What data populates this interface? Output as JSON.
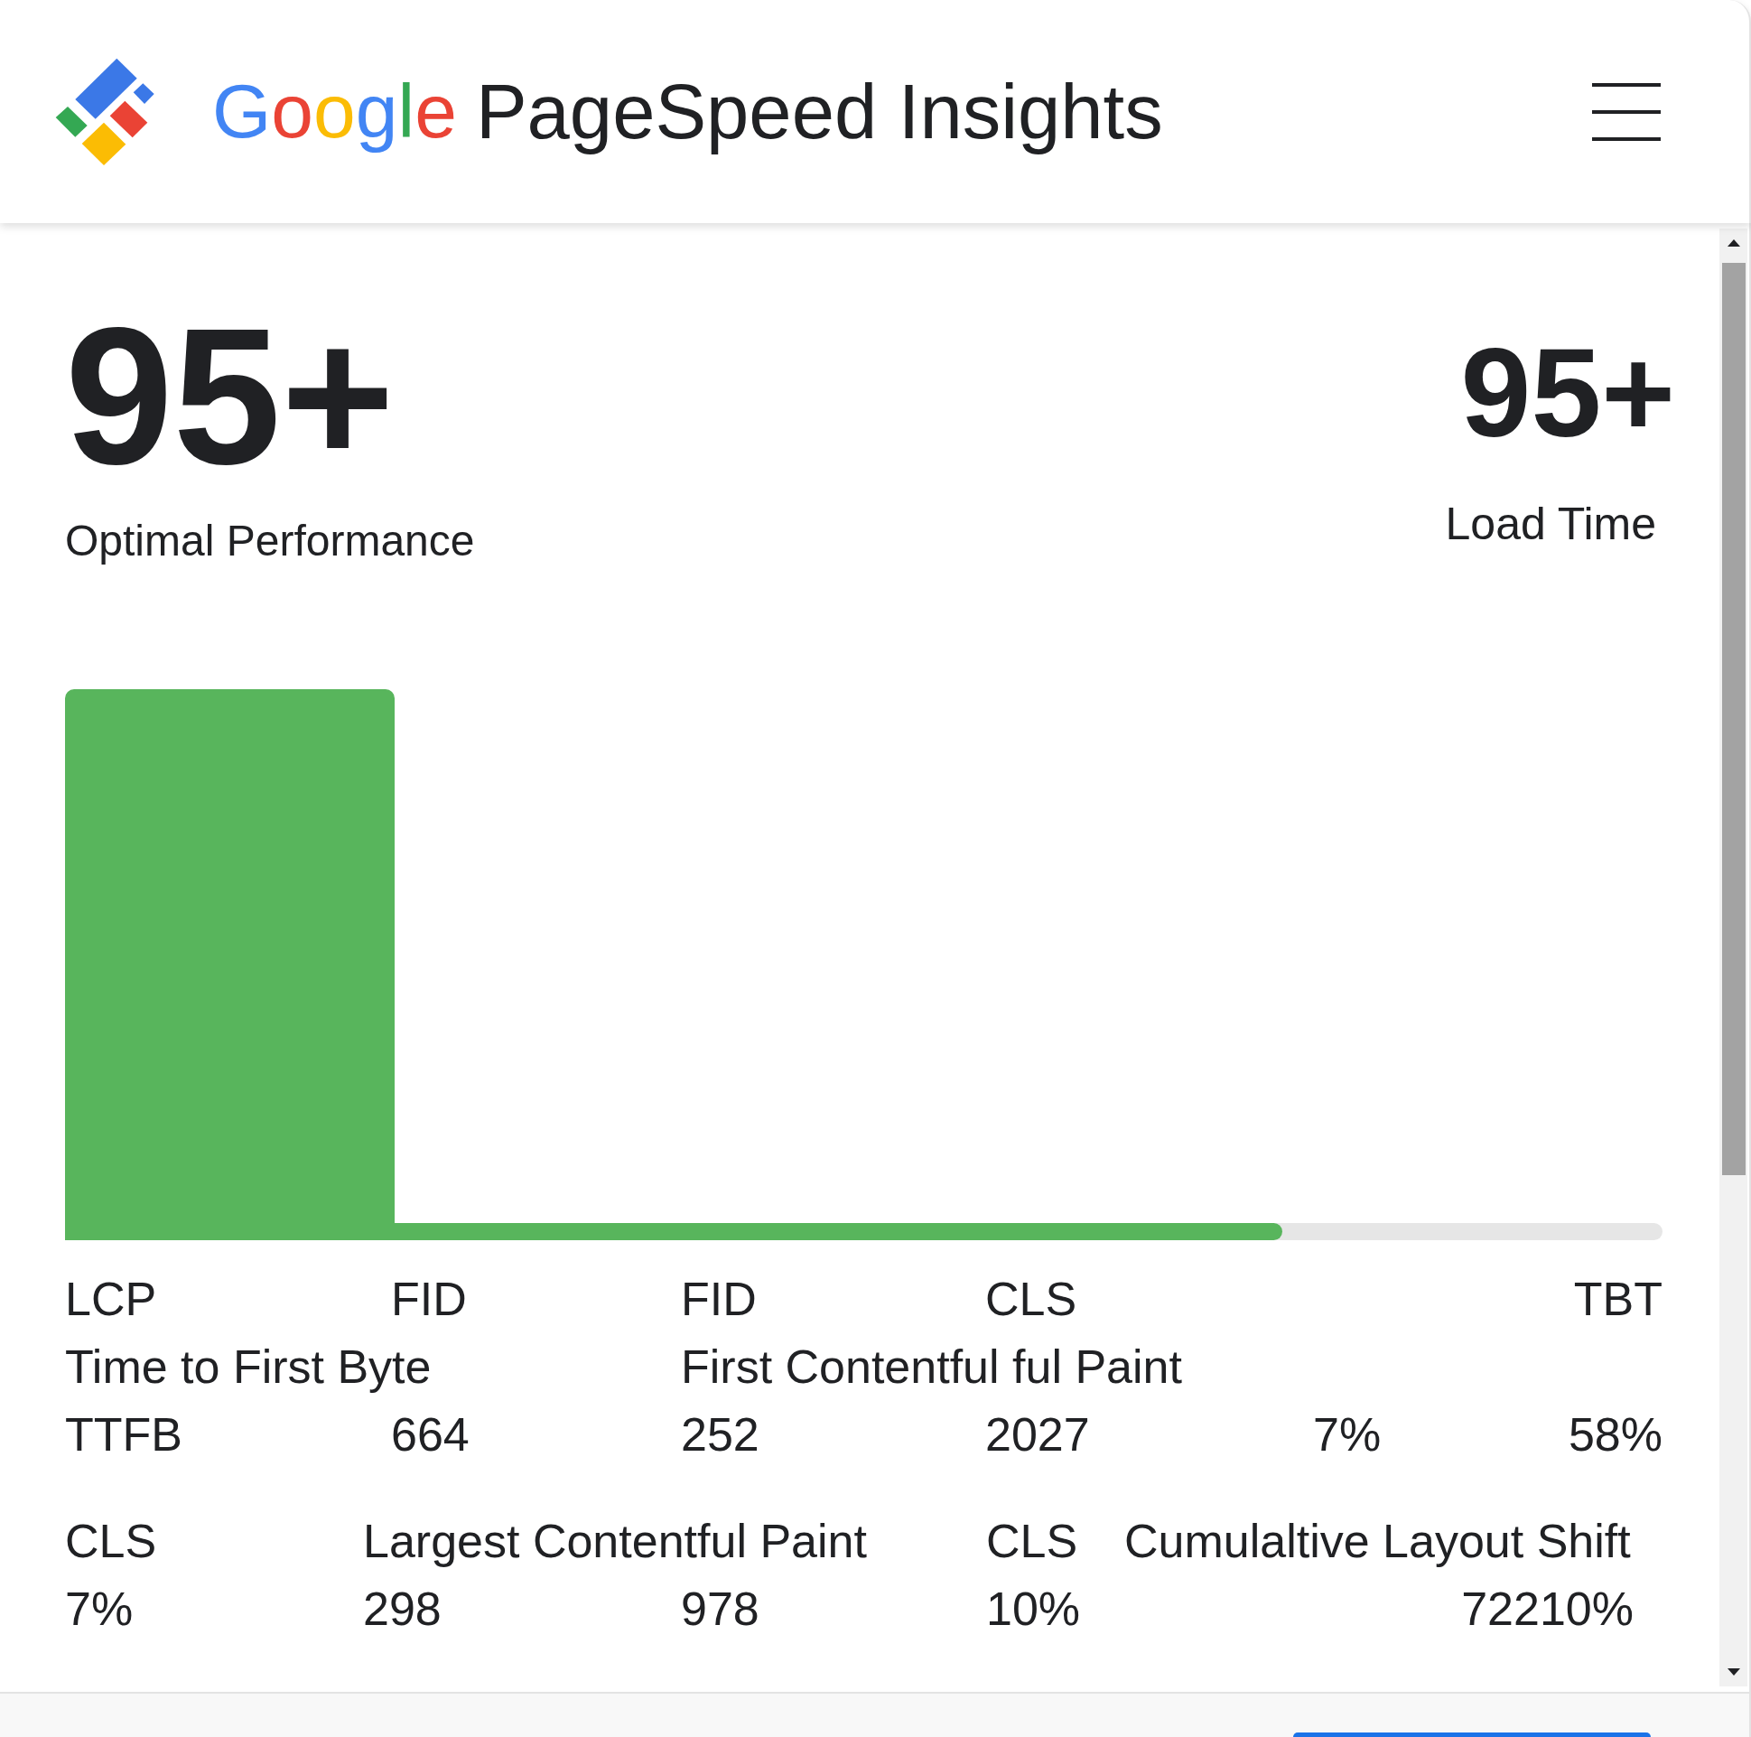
{
  "header": {
    "brand": "Google",
    "title": "PageSpeed Insights"
  },
  "scores": [
    {
      "kind": "primary",
      "value": "95+",
      "label": "Optimal Performance"
    },
    {
      "kind": "secondary",
      "value": "95+",
      "label": "Load Time"
    }
  ],
  "chart": {
    "progress": {
      "level": 0.7
    }
  },
  "metrics": {
    "rows": [
      [
        "LCP",
        "FID",
        "FID",
        "CLS",
        "",
        "TBT"
      ],
      [
        "Time to First Byte",
        "",
        "First Contentful ful Paint"
      ],
      [
        "TTFB",
        "664",
        "252",
        "2027",
        "7%",
        "58%"
      ]
    ]
  },
  "legend": {
    "rows": [
      [
        "CLS",
        "Largest Contentful Paint",
        "",
        "CLS",
        "Cumulaltive Layout Shift"
      ],
      [
        "7%",
        "298",
        "978",
        "10%",
        "72210%"
      ]
    ]
  }
}
